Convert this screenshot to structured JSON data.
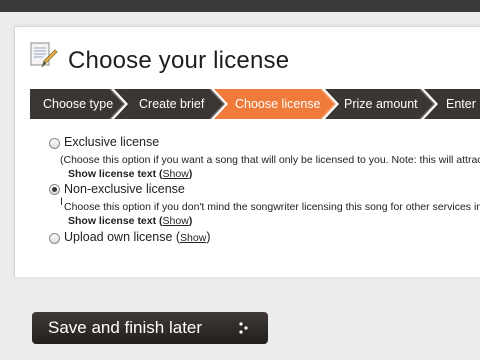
{
  "page": {
    "title": "Choose your license"
  },
  "steps": [
    {
      "label": "Choose type",
      "active": false
    },
    {
      "label": "Create brief",
      "active": false
    },
    {
      "label": "Choose license",
      "active": true
    },
    {
      "label": "Prize amount",
      "active": false
    },
    {
      "label": "Enter",
      "active": false
    }
  ],
  "colors": {
    "step_dark": "#3b3633",
    "step_active": "#f07a3a",
    "button_dark": "#2b2725"
  },
  "options": {
    "exclusive": {
      "label": "Exclusive license",
      "selected": false,
      "description": "(Choose this option if you want a song that will only be licensed to you. Note: this will attract fe",
      "show_text": "Show license text",
      "show_link": "Show"
    },
    "non_exclusive": {
      "label": "Non-exclusive license",
      "selected": true,
      "description": "Choose this option if you don't mind the songwriter licensing this song for other services in the",
      "show_text": "Show license text",
      "show_link": "Show"
    },
    "own": {
      "label": "Upload own license",
      "selected": false,
      "show_link": "Show"
    }
  },
  "actions": {
    "save_label": "Save and finish later"
  },
  "icons": {
    "doc": "document-pencil-icon",
    "arrow": "double-chevron-right-icon",
    "cursor": "text-cursor-icon"
  }
}
